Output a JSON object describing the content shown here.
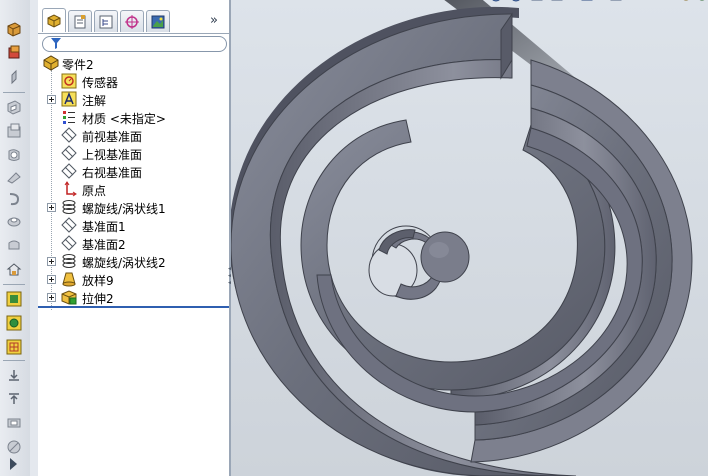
{
  "feature_manager": {
    "filter": {
      "placeholder": ""
    },
    "tree": [
      {
        "label": "零件2",
        "icon": "part-icon",
        "expandable": false
      },
      {
        "label": "传感器",
        "icon": "sensor-icon",
        "expandable": false
      },
      {
        "label": "注解",
        "icon": "annotation-icon",
        "expandable": true
      },
      {
        "label": "材质 <未指定>",
        "icon": "material-icon",
        "expandable": false
      },
      {
        "label": "前视基准面",
        "icon": "plane-icon",
        "expandable": false
      },
      {
        "label": "上视基准面",
        "icon": "plane-icon",
        "expandable": false
      },
      {
        "label": "右视基准面",
        "icon": "plane-icon",
        "expandable": false
      },
      {
        "label": "原点",
        "icon": "origin-icon",
        "expandable": false
      },
      {
        "label": "螺旋线/涡状线1",
        "icon": "helix-icon",
        "expandable": true
      },
      {
        "label": "基准面1",
        "icon": "plane-icon",
        "expandable": false
      },
      {
        "label": "基准面2",
        "icon": "plane-icon",
        "expandable": false
      },
      {
        "label": "螺旋线/涡状线2",
        "icon": "helix-icon",
        "expandable": true
      },
      {
        "label": "放样9",
        "icon": "loft-icon",
        "expandable": true
      },
      {
        "label": "拉伸2",
        "icon": "extrude-icon",
        "expandable": true
      }
    ]
  },
  "colors": {
    "model": "#6b6f7c",
    "model_dark": "#4f5260",
    "model_light": "#8e92a0",
    "selection_line": "#2f5fb0"
  }
}
